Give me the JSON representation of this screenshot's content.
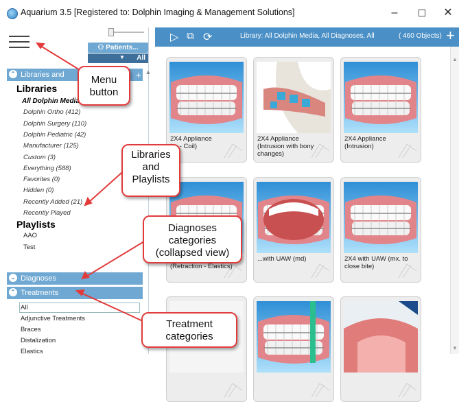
{
  "window": {
    "title": "Aquarium 3.5 [Registered to: Dolphin Imaging & Management Solutions]",
    "minimize": "–",
    "maximize": "☐",
    "close": "✕"
  },
  "left": {
    "patients_label": "Patients...",
    "patients_filter": "All",
    "libraries_header": "Libraries and",
    "libraries_heading": "Libraries",
    "libraries": [
      "All Dolphin Media",
      "Dolphin Ortho (412)",
      "Dolphin Surgery (110)",
      "Dolphin Pediatric (42)",
      "Manufacturer (125)",
      "Custom (3)",
      "Everything (588)",
      "Favorites (0)",
      "Hidden (0)",
      "Recently Added (21)",
      "Recently Played"
    ],
    "playlists_heading": "Playlists",
    "playlists": [
      "AAO",
      "Test"
    ],
    "diagnoses_header": "Diagnoses",
    "treatments_header": "Treatments",
    "treatments": [
      "All",
      "Adjunctive Treatments",
      "Braces",
      "Distalization",
      "Elastics"
    ]
  },
  "toolbar": {
    "library_title": "Library: All Dolphin Media, All Diagnoses, All",
    "object_count": "( 460 Objects)"
  },
  "thumbnails": [
    {
      "caption": "2X4 Appliance\n(... - Coil)",
      "kind": "teeth-front"
    },
    {
      "caption": "2X4 Appliance\n(Intrusion with bony\nchanges)",
      "kind": "jaw-side"
    },
    {
      "caption": "2X4 Appliance\n(Intrusion)",
      "kind": "teeth-front"
    },
    {
      "caption": "\n(Retraction - Elastics)",
      "kind": "teeth-front"
    },
    {
      "caption": "...with UAW (md)",
      "kind": "teeth-open"
    },
    {
      "caption": "2X4 with UAW (mx. to\nclose bite)",
      "kind": "teeth-front"
    },
    {
      "caption": "",
      "kind": "blank"
    },
    {
      "caption": "",
      "kind": "teeth-brush"
    },
    {
      "caption": "",
      "kind": "tongue"
    }
  ],
  "callouts": {
    "menu": "Menu\nbutton",
    "libraries": "Libraries\nand\nPlaylists",
    "diagnoses": "Diagnoses\ncategories\n(collapsed view)",
    "treatments": "Treatment\ncategories"
  },
  "colors": {
    "accent": "#4a8fc5",
    "header": "#6fa8d2",
    "callout_border": "#e23b3b"
  }
}
